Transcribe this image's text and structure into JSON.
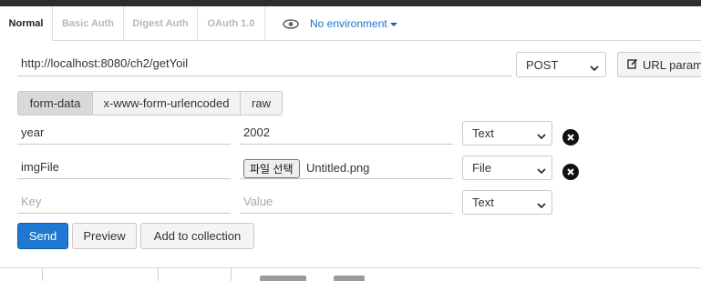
{
  "tabs": [
    {
      "label": "Normal",
      "active": true
    },
    {
      "label": "Basic Auth",
      "active": false
    },
    {
      "label": "Digest Auth",
      "active": false
    },
    {
      "label": "OAuth 1.0",
      "active": false
    }
  ],
  "environment": {
    "label": "No environment",
    "icon": "eye-icon"
  },
  "request": {
    "url": "http://localhost:8080/ch2/getYoil",
    "method": "POST",
    "url_params_label": "URL param"
  },
  "body_modes": [
    {
      "label": "form-data",
      "active": true
    },
    {
      "label": "x-www-form-urlencoded",
      "active": false
    },
    {
      "label": "raw",
      "active": false
    }
  ],
  "params": [
    {
      "key": "year",
      "value": "2002",
      "type": "Text"
    },
    {
      "key": "imgFile",
      "file_button": "파일 선택",
      "file_name": "Untitled.png",
      "type": "File"
    }
  ],
  "new_row": {
    "key_placeholder": "Key",
    "value_placeholder": "Value",
    "type": "Text"
  },
  "actions": {
    "send": "Send",
    "preview": "Preview",
    "add_to_collection": "Add to collection"
  },
  "colors": {
    "accent": "#1f78d1",
    "link": "#1a73c7"
  }
}
